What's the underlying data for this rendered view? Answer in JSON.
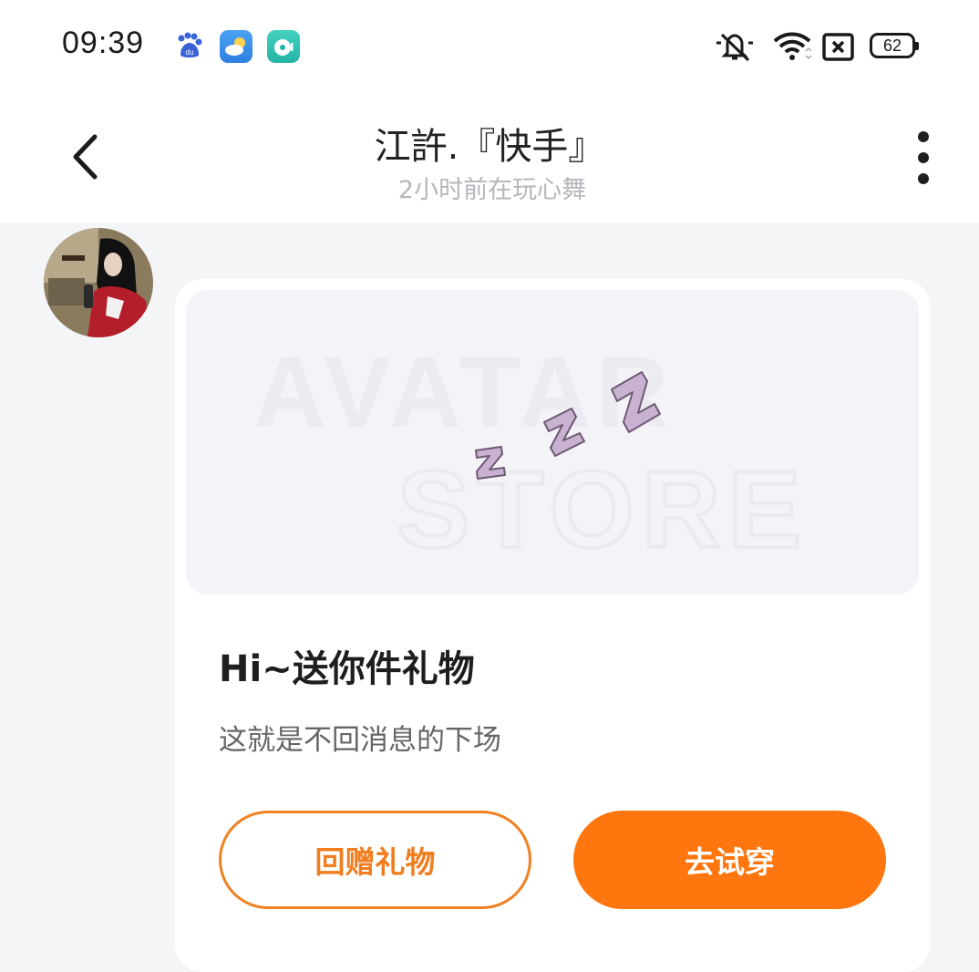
{
  "status_bar": {
    "time": "09:39",
    "battery": "62",
    "icons": [
      "baidu-icon",
      "weather-icon",
      "music-icon",
      "mute-icon",
      "wifi-icon",
      "no-sim-icon",
      "battery-icon"
    ]
  },
  "header": {
    "title": "江許.『快手』",
    "subtitle": "2小时前在玩心舞"
  },
  "message_card": {
    "banner_watermark_top": "AVATAR",
    "banner_watermark_bottom": "STORE",
    "title": "Hi~送你件礼物",
    "description": "这就是不回消息的下场",
    "secondary_button": "回赠礼物",
    "primary_button": "去试穿"
  },
  "colors": {
    "accent": "#fe760d",
    "outline": "#f08122",
    "zzz": "#c9b2d1"
  }
}
